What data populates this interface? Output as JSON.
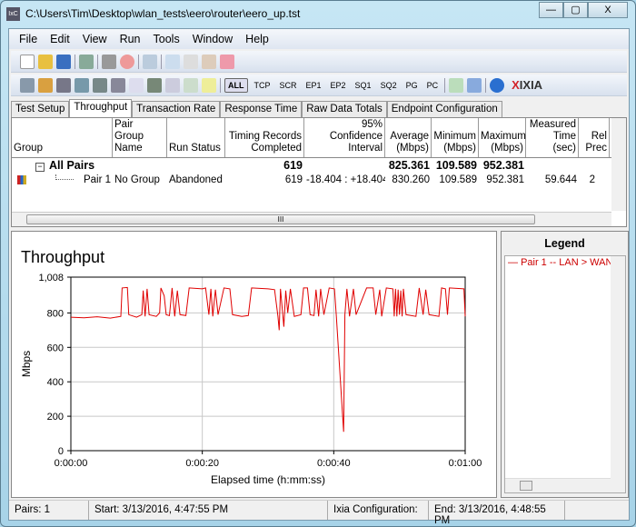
{
  "window": {
    "title": "C:\\Users\\Tim\\Desktop\\wlan_tests\\eero\\router\\eero_up.tst",
    "app_icon_text": "IxC",
    "controls": [
      "—",
      "▢",
      "X"
    ]
  },
  "menu": [
    "File",
    "Edit",
    "View",
    "Run",
    "Tools",
    "Window",
    "Help"
  ],
  "toolbar2_filters": [
    "ALL",
    "TCP",
    "SCR",
    "EP1",
    "EP2",
    "SQ1",
    "SQ2",
    "PG",
    "PC"
  ],
  "brand": {
    "x": "X",
    "name": "IXIA"
  },
  "tabs": [
    "Test Setup",
    "Throughput",
    "Transaction Rate",
    "Response Time",
    "Raw Data Totals",
    "Endpoint Configuration"
  ],
  "active_tab": "Throughput",
  "table": {
    "headers": [
      "Group",
      "Pair Group Name",
      "Run Status",
      "Timing Records Completed",
      "95% Confidence Interval",
      "Average (Mbps)",
      "Minimum (Mbps)",
      "Maximum (Mbps)",
      "Measured Time (sec)",
      "Rel Prec"
    ],
    "all_pairs": {
      "group": "All Pairs",
      "records": "619",
      "average": "825.361",
      "minimum": "109.589",
      "maximum": "952.381"
    },
    "pair": {
      "name": "Pair 1",
      "pair_group": "No Group",
      "status": "Abandoned",
      "records": "619",
      "ci": "-18.404 : +18.404",
      "average": "830.260",
      "minimum": "109.589",
      "maximum": "952.381",
      "measured_time": "59.644",
      "rel_prec": "2"
    },
    "scroll_thumb": "III"
  },
  "chart_data": {
    "type": "line",
    "title": "Throughput",
    "xlabel": "Elapsed time (h:mm:ss)",
    "ylabel": "Mbps",
    "xlim": [
      0,
      60
    ],
    "ylim": [
      0,
      1008
    ],
    "xticks": [
      "0:00:00",
      "0:00:20",
      "0:00:40",
      "0:01:00"
    ],
    "yticks": [
      "0",
      "200",
      "400",
      "600",
      "800",
      "1,008"
    ],
    "grid": true,
    "color": "#e00000",
    "series": [
      {
        "name": "Pair 1 -- LAN > WAN",
        "x": [
          0,
          2,
          4,
          6,
          7.6,
          7.8,
          8.6,
          8.8,
          10,
          10.8,
          11,
          11.3,
          11.6,
          11.9,
          13,
          13.5,
          13.7,
          14.2,
          14.5,
          15,
          15.4,
          15.8,
          16.2,
          16.6,
          17.5,
          18,
          20,
          20.5,
          21,
          21.3,
          21.6,
          22,
          22.4,
          23.3,
          24.2,
          24.6,
          26,
          27,
          27.5,
          30,
          31,
          31.5,
          31.7,
          31.9,
          32.4,
          32.7,
          33,
          33.4,
          34,
          35,
          35.4,
          36,
          36.4,
          37,
          37.3,
          37.7,
          38,
          38.5,
          39.3,
          40.1,
          40.4,
          41.5,
          41.7,
          42,
          42.4,
          43,
          43.4,
          45,
          46,
          46.4,
          47,
          47.3,
          48,
          49,
          49.2,
          49.4,
          49.6,
          49.8,
          50,
          50.2,
          50.4,
          50.6,
          51,
          52.5,
          53,
          53.6,
          54,
          54.5,
          56,
          56.4,
          57,
          57.3,
          57.6,
          59.8,
          60
        ],
        "y": [
          775,
          772,
          778,
          770,
          780,
          945,
          948,
          790,
          775,
          790,
          930,
          780,
          940,
          790,
          780,
          800,
          945,
          900,
          790,
          785,
          945,
          780,
          930,
          790,
          785,
          945,
          940,
          945,
          790,
          940,
          780,
          935,
          790,
          945,
          940,
          790,
          780,
          785,
          945,
          940,
          935,
          780,
          700,
          940,
          720,
          930,
          800,
          940,
          780,
          790,
          945,
          945,
          790,
          785,
          935,
          780,
          940,
          790,
          945,
          940,
          780,
          110,
          790,
          940,
          780,
          940,
          790,
          945,
          945,
          790,
          935,
          780,
          945,
          940,
          780,
          940,
          780,
          935,
          790,
          930,
          780,
          940,
          790,
          780,
          945,
          790,
          935,
          790,
          780,
          945,
          940,
          790,
          945,
          940,
          780
        ]
      }
    ]
  },
  "legend": {
    "title": "Legend",
    "items": [
      "Pair 1 -- LAN > WAN"
    ]
  },
  "status": {
    "pairs": "Pairs: 1",
    "start": "Start: 3/13/2016, 4:47:55 PM",
    "config": "Ixia Configuration:",
    "end": "End: 3/13/2016, 4:48:55 PM"
  }
}
